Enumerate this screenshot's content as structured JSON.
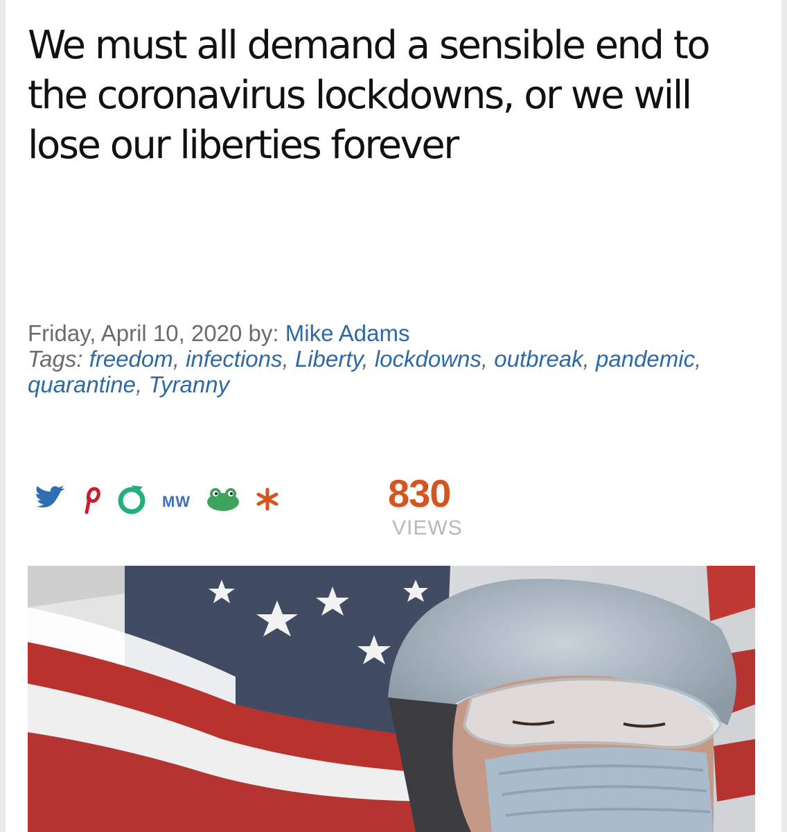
{
  "article": {
    "headline": "We must all demand a sensible end to the coronavirus lockdowns, or we will lose our liberties forever",
    "date_by": "Friday, April 10, 2020 by:",
    "author": "Mike Adams",
    "tags_label": "Tags:",
    "tags": [
      "freedom",
      "infections",
      "Liberty",
      "lockdowns",
      "outbreak",
      "pandemic",
      "quarantine",
      "Tyranny"
    ]
  },
  "share": {
    "icons": [
      "twitter-icon",
      "pinterest-icon",
      "gab-icon",
      "mewe-icon",
      "parler-icon",
      "star-icon"
    ],
    "mewe_text": "MW"
  },
  "views": {
    "count": "830",
    "label": "VIEWS"
  },
  "colors": {
    "link": "#2d6aa5",
    "views_count": "#d6541f",
    "twitter": "#2d6fb4",
    "pinterest": "#c81f2a",
    "gab": "#22b07a",
    "parler": "#3da35d",
    "star": "#d6541f"
  },
  "image": {
    "subject": "health-worker-flag-photo"
  }
}
